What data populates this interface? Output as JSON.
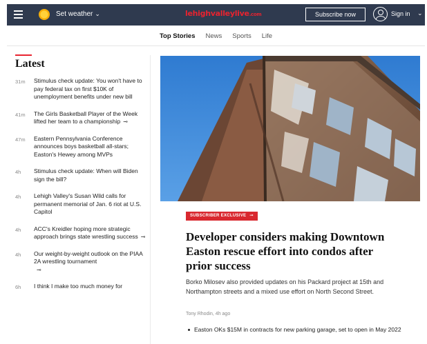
{
  "header": {
    "weather_label": "Set weather",
    "logo_main": "lehighvalleylive",
    "logo_suffix": ".com",
    "subscribe_label": "Subscribe now",
    "signin_label": "Sign in"
  },
  "nav": {
    "tabs": [
      {
        "label": "Top Stories",
        "active": true
      },
      {
        "label": "News"
      },
      {
        "label": "Sports"
      },
      {
        "label": "Life"
      }
    ]
  },
  "latest": {
    "heading": "Latest",
    "items": [
      {
        "time": "31m",
        "title": "Stimulus check update: You won't have to pay federal tax on first $10K of unemployment benefits under new bill",
        "exclusive": false
      },
      {
        "time": "41m",
        "title": "The Girls Basketball Player of the Week lifted her team to a championship",
        "exclusive": true
      },
      {
        "time": "47m",
        "title": "Eastern Pennsylvania Conference announces boys basketball all-stars; Easton's Hewey among MVPs",
        "exclusive": false
      },
      {
        "time": "4h",
        "title": "Stimulus check update: When will Biden sign the bill?",
        "exclusive": false
      },
      {
        "time": "4h",
        "title": "Lehigh Valley's Susan Wild calls for permanent memorial of Jan. 6 riot at U.S. Capitol",
        "exclusive": false
      },
      {
        "time": "4h",
        "title": "ACC's Kreidler hoping more strategic approach brings state wrestling success",
        "exclusive": true
      },
      {
        "time": "4h",
        "title": "Our weight-by-weight outlook on the PIAA 2A wrestling tournament",
        "exclusive": true
      },
      {
        "time": "6h",
        "title": "I think I make too much money for",
        "exclusive": false
      }
    ]
  },
  "feature": {
    "badge": "SUBSCRIBER EXCLUSIVE",
    "headline": "Developer considers making Downtown Easton rescue effort into condos after prior success",
    "summary": "Borko Milosev also provided updates on his Packard project at 15th and Northampton streets and a mixed use effort on North Second Street.",
    "byline": "Tony Rhodin, 4h ago",
    "related": "Easton OKs $15M in contracts for new parking garage, set to open in May 2022"
  },
  "icons": {
    "menu": "hamburger-menu-icon",
    "weather": "sun-icon",
    "user": "user-avatar-icon",
    "exclusive": "key-icon"
  },
  "colors": {
    "topbar": "#2f3a4f",
    "brand_red": "#e8232f",
    "badge_red": "#d9282f"
  }
}
